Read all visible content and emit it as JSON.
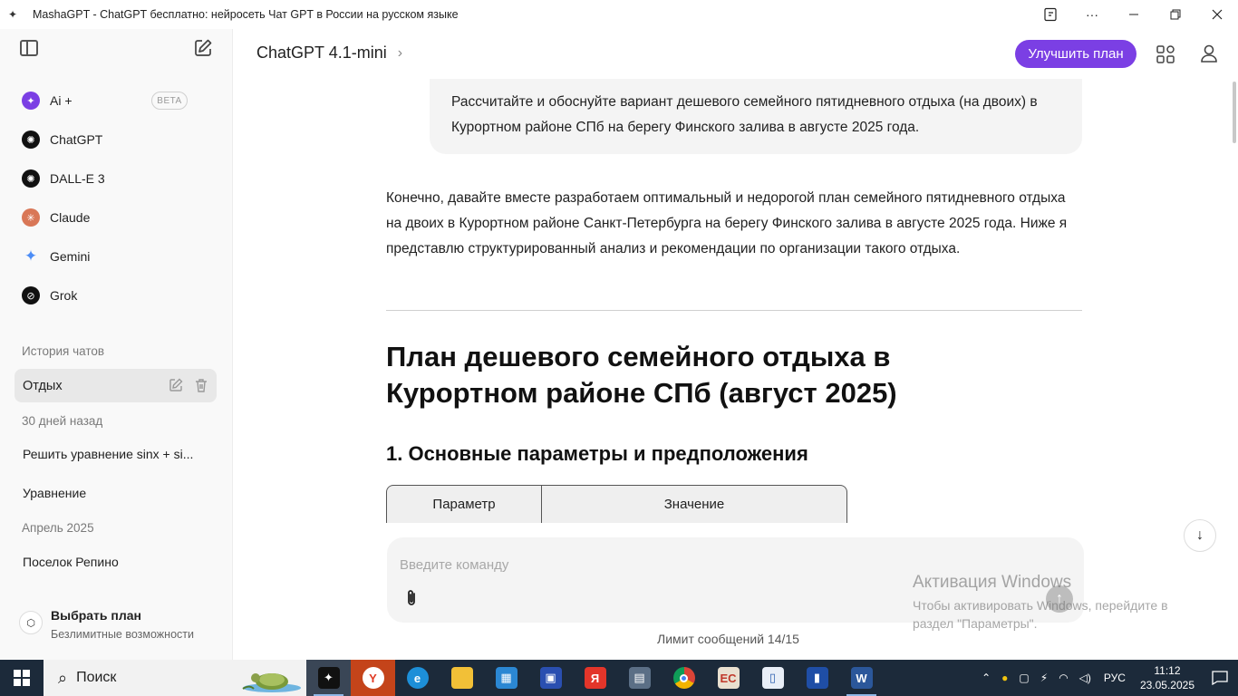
{
  "window": {
    "title": "MashaGPT - ChatGPT бесплатно: нейросеть Чат GPT в России на русском языке"
  },
  "sidebar": {
    "models": [
      {
        "label": "Ai +",
        "icon": "ai-plus-icon",
        "color": "#7b3fe4"
      },
      {
        "label": "ChatGPT",
        "icon": "openai-icon",
        "color": "#111111"
      },
      {
        "label": "DALL-E 3",
        "icon": "openai-icon",
        "color": "#111111"
      },
      {
        "label": "Claude",
        "icon": "claude-icon",
        "color": "#d97757"
      },
      {
        "label": "Gemini",
        "icon": "gemini-icon",
        "color": "#4c8df6"
      },
      {
        "label": "Grok",
        "icon": "grok-icon",
        "color": "#111111"
      }
    ],
    "beta_badge": "BETA",
    "history_label": "История чатов",
    "active_chat": "Отдых",
    "section_30_days": "30 дней назад",
    "chats_30_days": [
      "Решить уравнение sinx + si...",
      "Уравнение"
    ],
    "section_april": "Апрель 2025",
    "chats_april": [
      "Поселок Репино"
    ],
    "plan": {
      "title": "Выбрать план",
      "subtitle": "Безлимитные возможности"
    }
  },
  "header": {
    "model_name": "ChatGPT 4.1-mini",
    "upgrade_label": "Улучшить план"
  },
  "conversation": {
    "user_message": "Рассчитайте и обоснуйте вариант дешевого семейного пятидневного отдыха (на двоих) в Курортном районе СПб на берегу Финского залива в августе 2025 года.",
    "assistant_intro": "Конечно, давайте вместе разработаем оптимальный и недорогой план семейного пятидневного отдыха на двоих в Курортном районе Санкт-Петербурга на берегу Финского залива в августе 2025 года. Ниже я представлю структурированный анализ и рекомендации по организации такого отдыха.",
    "heading1": "План дешевого семейного отдыха в Курортном районе СПб (август 2025)",
    "heading2": "1. Основные параметры и предположения",
    "table_headers": [
      "Параметр",
      "Значение"
    ]
  },
  "composer": {
    "placeholder": "Введите команду",
    "limit_text": "Лимит сообщений 14/15"
  },
  "watermark": {
    "title": "Активация Windows",
    "subtitle": "Чтобы активировать Windows, перейдите в раздел \"Параметры\"."
  },
  "taskbar": {
    "search_label": "Поиск",
    "language": "РУС",
    "time": "11:12",
    "date": "23.05.2025"
  },
  "colors": {
    "accent": "#7b3fe4",
    "taskbar": "#1c2a3a"
  }
}
